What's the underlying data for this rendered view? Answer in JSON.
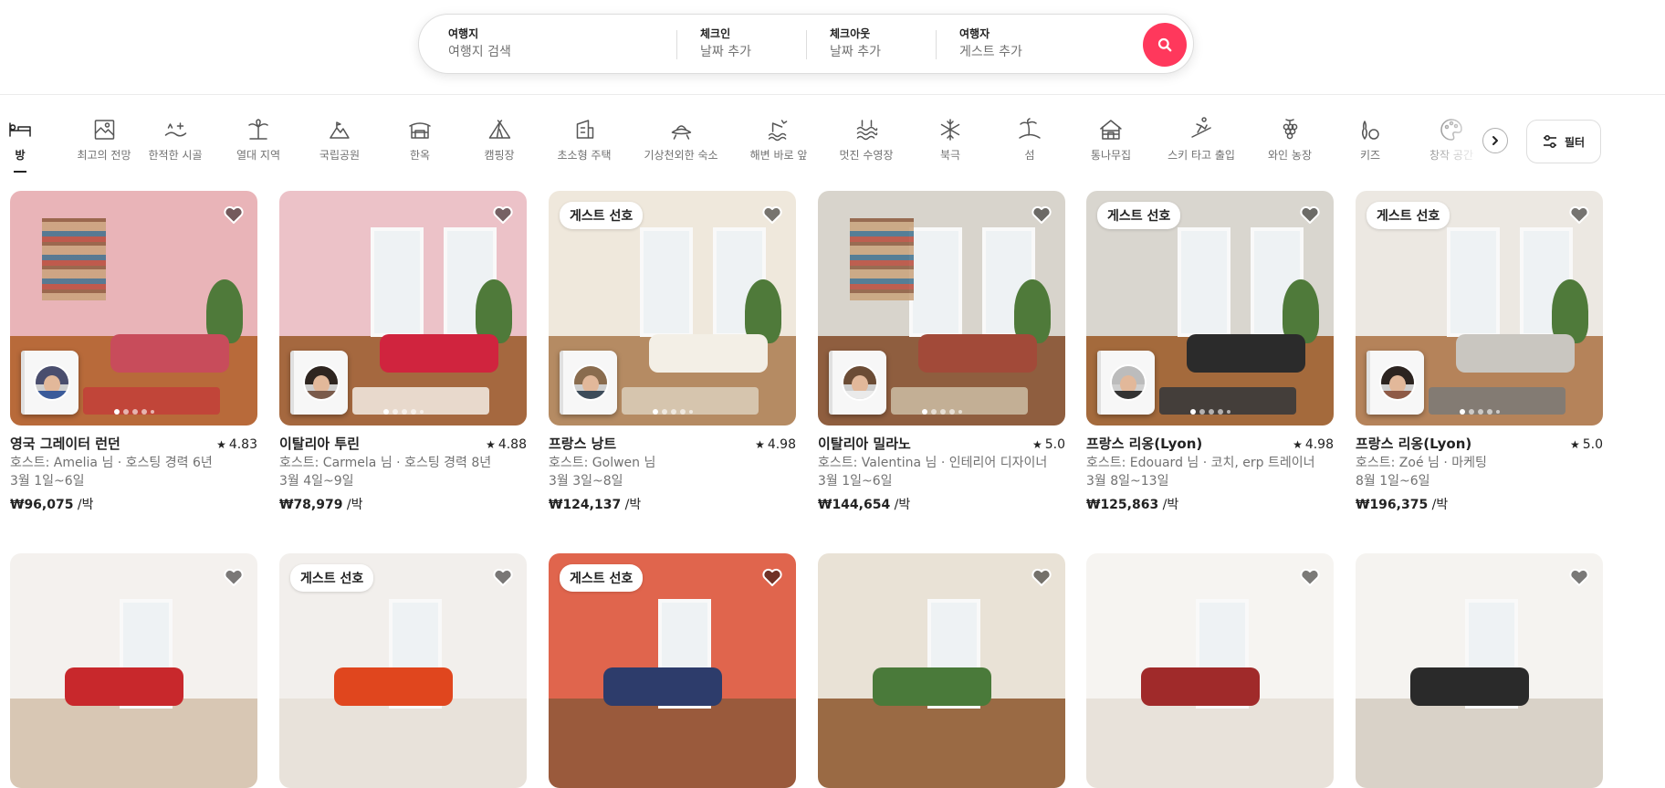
{
  "search": {
    "where_label": "여행지",
    "where_placeholder": "여행지 검색",
    "checkin_label": "체크인",
    "checkin_placeholder": "날짜 추가",
    "checkout_label": "체크아웃",
    "checkout_placeholder": "날짜 추가",
    "guests_label": "여행자",
    "guests_placeholder": "게스트 추가",
    "button_icon": "search-icon",
    "accent": "#ff385c"
  },
  "categories": [
    {
      "label": "방",
      "icon": "bed-icon",
      "active": true
    },
    {
      "label": "최고의 전망",
      "icon": "view-frame-icon"
    },
    {
      "label": "한적한 시골",
      "icon": "countryside-icon"
    },
    {
      "label": "열대 지역",
      "icon": "palm-tree-icon"
    },
    {
      "label": "국립공원",
      "icon": "mountain-icon"
    },
    {
      "label": "한옥",
      "icon": "hanok-icon"
    },
    {
      "label": "캠핑장",
      "icon": "tent-icon"
    },
    {
      "label": "초소형 주택",
      "icon": "tiny-home-icon"
    },
    {
      "label": "기상천외한 숙소",
      "icon": "ufo-icon"
    },
    {
      "label": "해변 바로 앞",
      "icon": "beachfront-icon"
    },
    {
      "label": "멋진 수영장",
      "icon": "pool-icon"
    },
    {
      "label": "북극",
      "icon": "snowflake-icon"
    },
    {
      "label": "섬",
      "icon": "island-icon"
    },
    {
      "label": "통나무집",
      "icon": "cabin-icon"
    },
    {
      "label": "스키 타고 출입",
      "icon": "ski-icon"
    },
    {
      "label": "와인 농장",
      "icon": "grapes-icon"
    },
    {
      "label": "키즈",
      "icon": "bowling-icon"
    },
    {
      "label": "창작 공간",
      "icon": "palette-icon"
    }
  ],
  "filter": {
    "label": "필터",
    "icon": "sliders-icon"
  },
  "listings": [
    {
      "title": "영국 그레이터 런던",
      "rating": "4.83",
      "host": "호스트: Amelia 님 · 호스팅 경력 6년",
      "dates": "3월 1일~6일",
      "price": "₩96,075",
      "per_night": " /박",
      "badge": ""
    },
    {
      "title": "이탈리아 투린",
      "rating": "4.88",
      "host": "호스트: Carmela 님 · 호스팅 경력 8년",
      "dates": "3월 4일~9일",
      "price": "₩78,979",
      "per_night": " /박",
      "badge": ""
    },
    {
      "title": "프랑스 낭트",
      "rating": "4.98",
      "host": "호스트: Golwen 님",
      "dates": "3월 3일~8일",
      "price": "₩124,137",
      "per_night": " /박",
      "badge": "게스트 선호"
    },
    {
      "title": "이탈리아 밀라노",
      "rating": "5.0",
      "host": "호스트: Valentina 님 · 인테리어 디자이너",
      "dates": "3월 1일~6일",
      "price": "₩144,654",
      "per_night": " /박",
      "badge": ""
    },
    {
      "title": "프랑스 리옹(Lyon)",
      "rating": "4.98",
      "host": "호스트: Edouard 님 · 코치, erp 트레이너",
      "dates": "3월 8일~13일",
      "price": "₩125,863",
      "per_night": " /박",
      "badge": "게스트 선호"
    },
    {
      "title": "프랑스 리옹(Lyon)",
      "rating": "5.0",
      "host": "호스트: Zoé 님 · 마케팅",
      "dates": "8월 1일~6일",
      "price": "₩196,375",
      "per_night": " /박",
      "badge": "게스트 선호"
    }
  ],
  "listings_row2": [
    {
      "badge": ""
    },
    {
      "badge": "게스트 선호"
    },
    {
      "badge": "게스트 선호"
    },
    {
      "badge": ""
    },
    {
      "badge": ""
    },
    {
      "badge": ""
    }
  ]
}
